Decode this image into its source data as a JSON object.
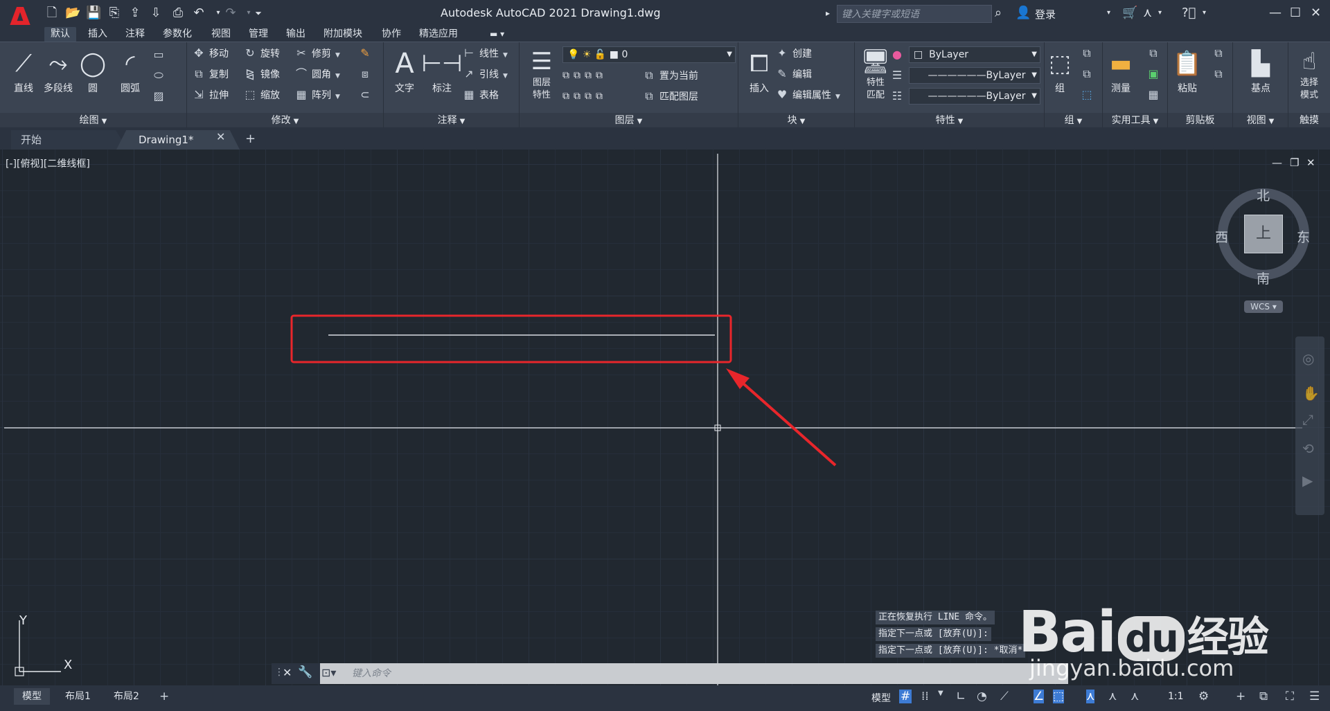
{
  "app": {
    "logo_letter": "A",
    "title": "Autodesk AutoCAD 2021    Drawing1.dwg",
    "search_placeholder": "键入关键字或短语",
    "login": "登录"
  },
  "menu_tabs": [
    "默认",
    "插入",
    "注释",
    "参数化",
    "视图",
    "管理",
    "输出",
    "附加模块",
    "协作",
    "精选应用"
  ],
  "ribbon": {
    "draw": {
      "label": "绘图",
      "line": "直线",
      "polyline": "多段线",
      "circle": "圆",
      "arc": "圆弧"
    },
    "modify": {
      "label": "修改",
      "move": "移动",
      "rotate": "旋转",
      "trim": "修剪",
      "copy": "复制",
      "mirror": "镜像",
      "fillet": "圆角",
      "stretch": "拉伸",
      "scale": "缩放",
      "array": "阵列"
    },
    "annotation": {
      "label": "注释",
      "text": "文字",
      "dimension": "标注",
      "linear": "线性",
      "leader": "引线",
      "table": "表格"
    },
    "layers": {
      "label": "图层",
      "layer_props_1": "图层",
      "layer_props_2": "特性",
      "layer_value": "0",
      "set_current": "置为当前",
      "match_layer": "匹配图层"
    },
    "block": {
      "label": "块",
      "insert": "插入",
      "create": "创建",
      "edit": "编辑",
      "edit_attr": "编辑属性"
    },
    "properties": {
      "label": "特性",
      "match_1": "特性",
      "match_2": "匹配",
      "color": "ByLayer",
      "lineweight": "ByLayer",
      "linetype": "ByLayer"
    },
    "groups": {
      "label": "组",
      "group": "组"
    },
    "utilities": {
      "label": "实用工具",
      "measure": "测量"
    },
    "clipboard": {
      "label": "剪贴板",
      "paste": "粘贴"
    },
    "view": {
      "label": "视图",
      "base": "基点"
    },
    "touch": {
      "label": "触摸",
      "select_mode_1": "选择",
      "select_mode_2": "模式"
    }
  },
  "doc_tabs": {
    "start": "开始",
    "drawing": "Drawing1*"
  },
  "viewport": {
    "label": "[-][俯视][二维线框]"
  },
  "viewcube": {
    "north": "北",
    "south": "南",
    "east": "东",
    "west": "西",
    "face": "上",
    "wcs": "WCS"
  },
  "ucs": {
    "x": "X",
    "y": "Y"
  },
  "command_history": [
    "正在恢复执行 LINE 命令。",
    "指定下一点或 [放弃(U)]:",
    "指定下一点或 [放弃(U)]: *取消*"
  ],
  "command_input_placeholder": "键入命令",
  "layout_tabs": [
    "模型",
    "布局1",
    "布局2"
  ],
  "status": {
    "model": "模型",
    "scale": "1:1"
  },
  "watermark": {
    "brand": "Bai",
    "brand_du": "du",
    "brand_suffix": "经验",
    "url": "jingyan.baidu.com"
  },
  "colors": {
    "highlight_box": "#e8262b",
    "arrow": "#e8262b",
    "background": "#212830"
  }
}
